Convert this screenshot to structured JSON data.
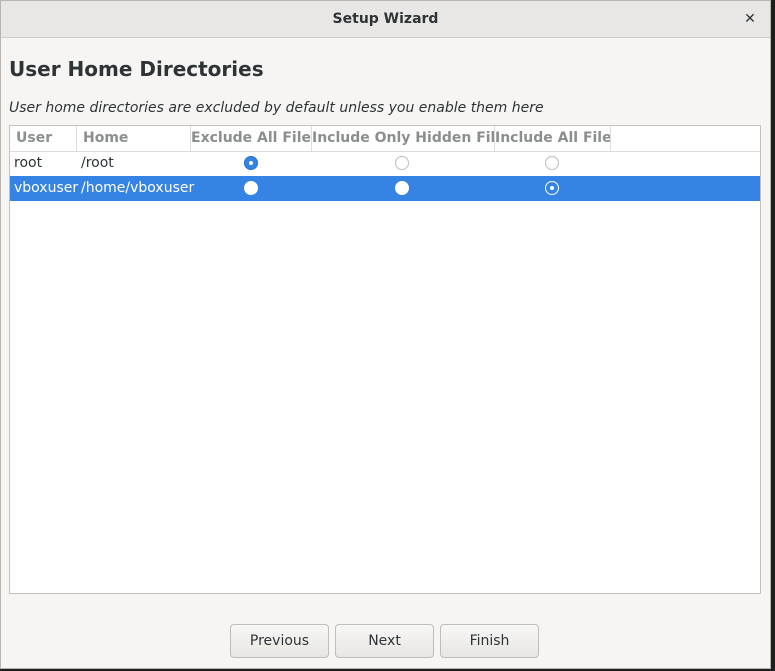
{
  "window": {
    "title": "Setup Wizard",
    "close_glyph": "✕"
  },
  "page": {
    "heading": "User Home Directories",
    "subtitle": "User home directories are excluded by default unless you enable them here"
  },
  "table": {
    "columns": [
      "User",
      "Home",
      "Exclude All Files",
      "Include Only Hidden Files",
      "Include All Files"
    ],
    "rows": [
      {
        "user": "root",
        "home": "/root",
        "selected_option": "Exclude All Files",
        "row_selected": false
      },
      {
        "user": "vboxuser",
        "home": "/home/vboxuser",
        "selected_option": "Include All Files",
        "row_selected": true
      }
    ]
  },
  "buttons": {
    "previous": "Previous",
    "next": "Next",
    "finish": "Finish"
  },
  "colors": {
    "accent": "#3584e4",
    "window_bg": "#f6f5f4",
    "titlebar_bg": "#e8e7e6"
  }
}
